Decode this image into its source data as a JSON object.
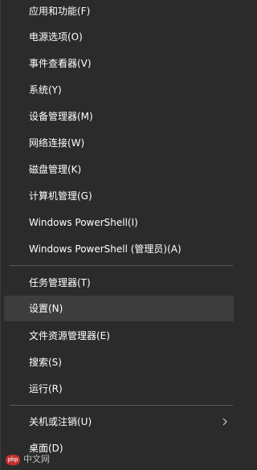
{
  "menu": {
    "groups": [
      {
        "items": [
          {
            "label": "应用和功能(F)"
          },
          {
            "label": "电源选项(O)"
          },
          {
            "label": "事件查看器(V)"
          },
          {
            "label": "系统(Y)"
          },
          {
            "label": "设备管理器(M)"
          },
          {
            "label": "网络连接(W)"
          },
          {
            "label": "磁盘管理(K)"
          },
          {
            "label": "计算机管理(G)"
          },
          {
            "label": "Windows PowerShell(I)"
          },
          {
            "label": "Windows PowerShell (管理员)(A)"
          }
        ]
      },
      {
        "items": [
          {
            "label": "任务管理器(T)"
          },
          {
            "label": "设置(N)",
            "hovered": true
          },
          {
            "label": "文件资源管理器(E)"
          },
          {
            "label": "搜索(S)"
          },
          {
            "label": "运行(R)"
          }
        ]
      },
      {
        "items": [
          {
            "label": "关机或注销(U)",
            "submenu": true,
            "submenu_icon": "chevron-right-icon"
          },
          {
            "label": "桌面(D)"
          }
        ]
      }
    ]
  },
  "watermark": {
    "logo_text": "php",
    "text": "中文网"
  },
  "colors": {
    "background": "#2b2b2b",
    "hover": "#3d3d3d",
    "divider": "#5a5a5a",
    "text": "#ffffff"
  }
}
